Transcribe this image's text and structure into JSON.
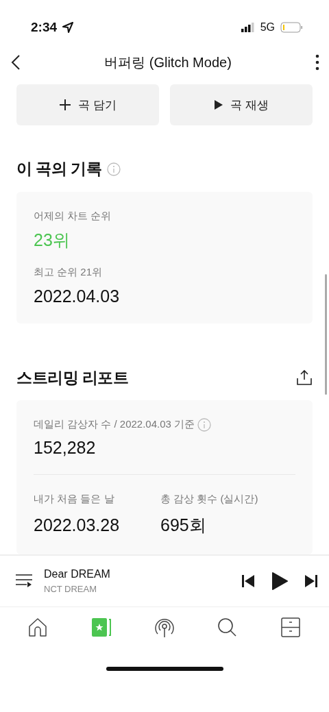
{
  "status_bar": {
    "time": "2:34",
    "network": "5G"
  },
  "header": {
    "title": "버퍼링 (Glitch Mode)"
  },
  "actions": [
    {
      "kind": "add",
      "label": "곡 담기"
    },
    {
      "kind": "play",
      "label": "곡 재생"
    }
  ],
  "record": {
    "title": "이 곡의 기록",
    "yesterday_label": "어제의 차트 순위",
    "yesterday_rank": "23위",
    "best_label": "최고 순위 21위",
    "best_date": "2022.04.03"
  },
  "report": {
    "title": "스트리밍 리포트",
    "daily_label": "데일리 감상자 수 / 2022.04.03 기준",
    "daily_value": "152,282",
    "stats": [
      {
        "label": "내가 처음 들은 날",
        "value": "2022.03.28"
      },
      {
        "label": "총 감상 횟수 (실시간)",
        "value": "695회"
      }
    ]
  },
  "now_playing": {
    "title": "Dear DREAM",
    "artist": "NCT DREAM"
  },
  "tabs": [
    {
      "kind": "home",
      "selected": false
    },
    {
      "kind": "chart",
      "selected": true
    },
    {
      "kind": "station",
      "selected": false
    },
    {
      "kind": "search",
      "selected": false
    },
    {
      "kind": "library",
      "selected": false
    }
  ]
}
